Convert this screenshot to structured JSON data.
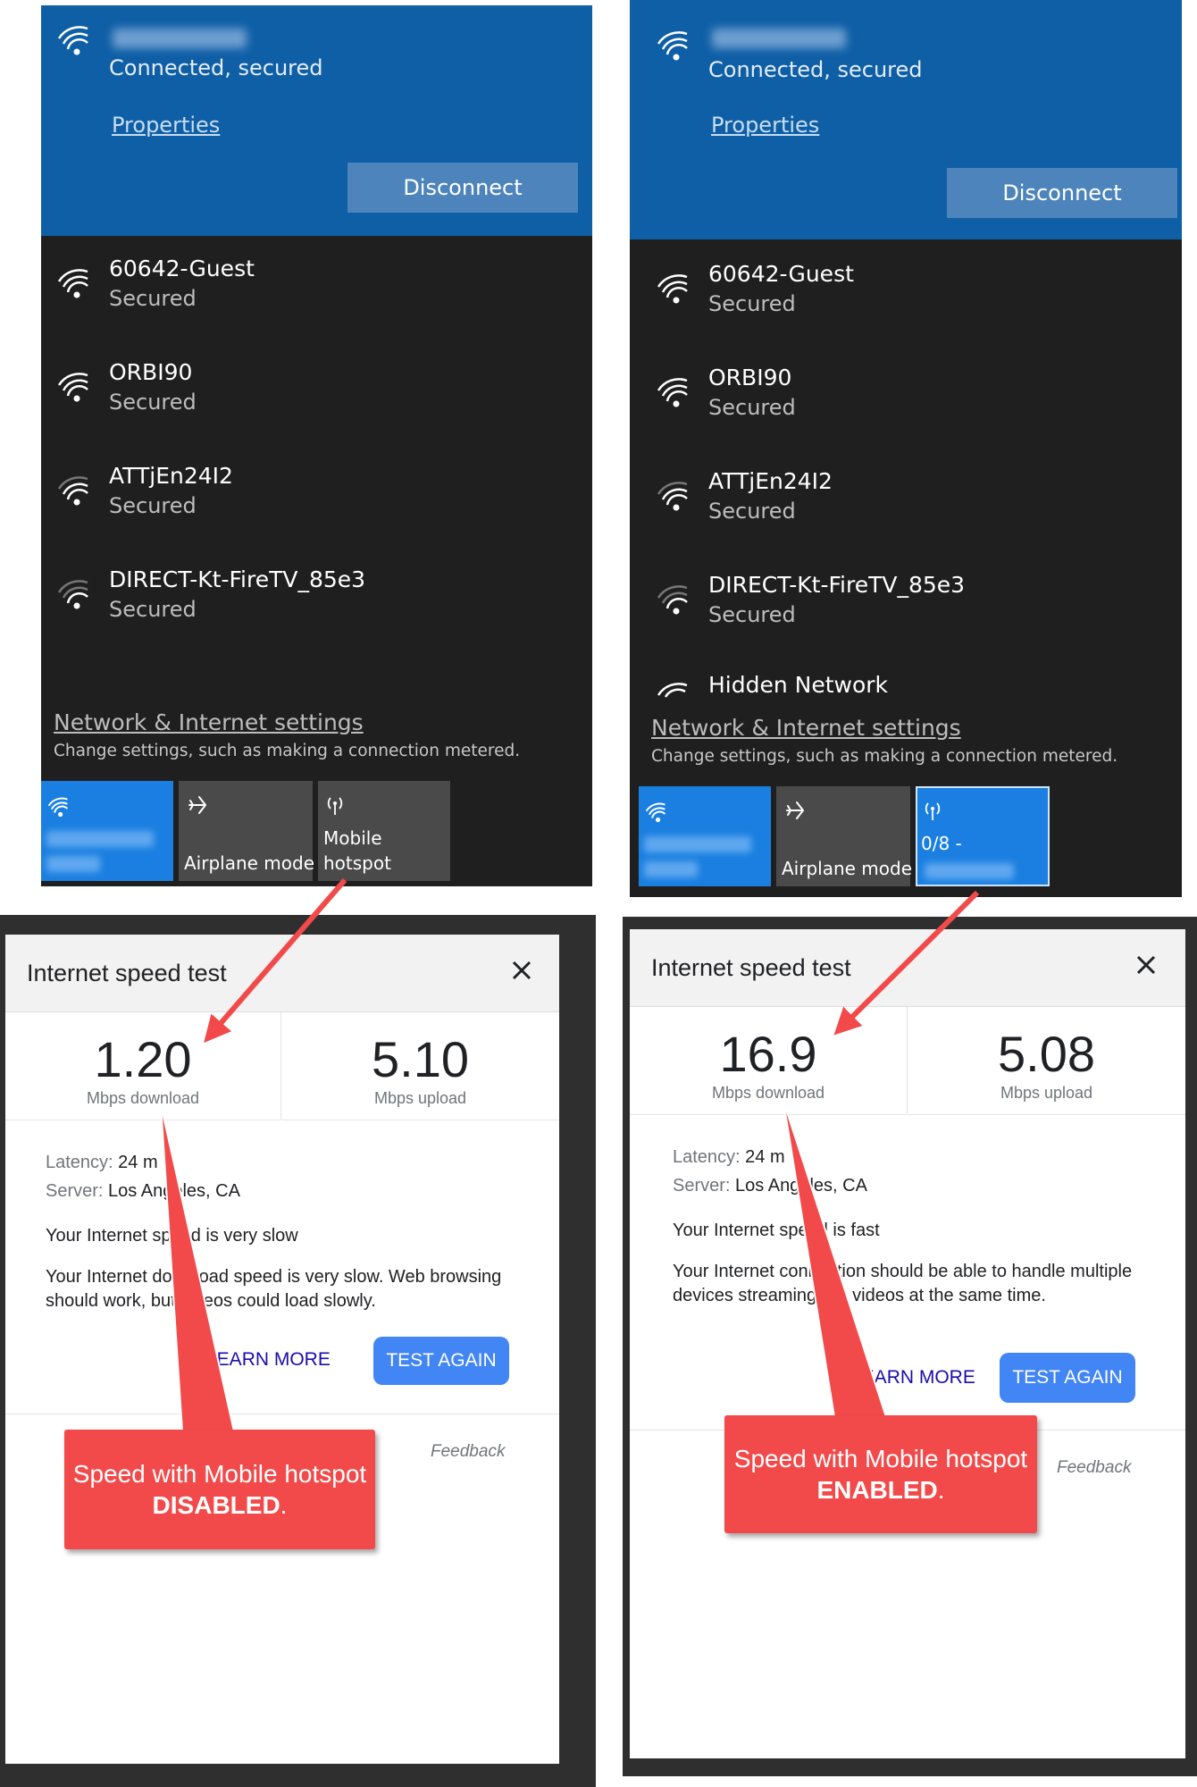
{
  "panels": [
    {
      "connected": {
        "status": "Connected, secured",
        "properties_label": "Properties",
        "disconnect_label": "Disconnect"
      },
      "networks": [
        {
          "name": "60642-Guest",
          "status": "Secured"
        },
        {
          "name": "ORBI90",
          "status": "Secured"
        },
        {
          "name": "ATTjEn24I2",
          "status": "Secured"
        },
        {
          "name": "DIRECT-Kt-FireTV_85e3",
          "status": "Secured"
        }
      ],
      "settings_link": "Network & Internet settings",
      "settings_desc": "Change settings, such as making a connection metered.",
      "tiles": {
        "airplane_label": "Airplane mode",
        "hotspot_line1": "Mobile",
        "hotspot_line2": "hotspot"
      },
      "speed": {
        "title": "Internet speed test",
        "download_value": "1.20",
        "download_unit": "Mbps download",
        "upload_value": "5.10",
        "upload_unit": "Mbps upload",
        "latency_label": "Latency:",
        "latency_value": "24 m",
        "server_label": "Server:",
        "server_value": "Los Angeles, CA",
        "verdict": "Your Internet speed is very slow",
        "description": "Your Internet download speed is very slow. Web browsing should work, but videos could load slowly.",
        "learn_more": "LEARN MORE",
        "test_again": "TEST AGAIN",
        "feedback": "Feedback"
      },
      "callout": {
        "text_before": "Speed with Mobile hotspot ",
        "text_bold": "DISABLED",
        "text_after": "."
      }
    },
    {
      "connected": {
        "status": "Connected, secured",
        "properties_label": "Properties",
        "disconnect_label": "Disconnect"
      },
      "networks": [
        {
          "name": "60642-Guest",
          "status": "Secured"
        },
        {
          "name": "ORBI90",
          "status": "Secured"
        },
        {
          "name": "ATTjEn24I2",
          "status": "Secured"
        },
        {
          "name": "DIRECT-Kt-FireTV_85e3",
          "status": "Secured"
        },
        {
          "name": "Hidden Network",
          "status": ""
        }
      ],
      "settings_link": "Network & Internet settings",
      "settings_desc": "Change settings, such as making a connection metered.",
      "tiles": {
        "airplane_label": "Airplane mode",
        "hotspot_count": "0/8 -"
      },
      "speed": {
        "title": "Internet speed test",
        "download_value": "16.9",
        "download_unit": "Mbps download",
        "upload_value": "5.08",
        "upload_unit": "Mbps upload",
        "latency_label": "Latency:",
        "latency_value": "24 m",
        "server_label": "Server:",
        "server_value": "Los Angeles, CA",
        "verdict": "Your Internet speed is fast",
        "description": "Your Internet connection should be able to handle multiple devices streaming HD videos at the same time.",
        "learn_more": "LEARN MORE",
        "test_again": "TEST AGAIN",
        "feedback": "Feedback"
      },
      "callout": {
        "text_before": "Speed with Mobile hotspot ",
        "text_bold": "ENABLED",
        "text_after": "."
      }
    }
  ],
  "colors": {
    "connected_bg": "#0f5fa6",
    "flyout_bg": "#1f1f1f",
    "tile_active": "#1a7fe0",
    "tile_inactive": "#4a4a4a",
    "callout": "#f24a4a",
    "button": "#4285f4"
  }
}
